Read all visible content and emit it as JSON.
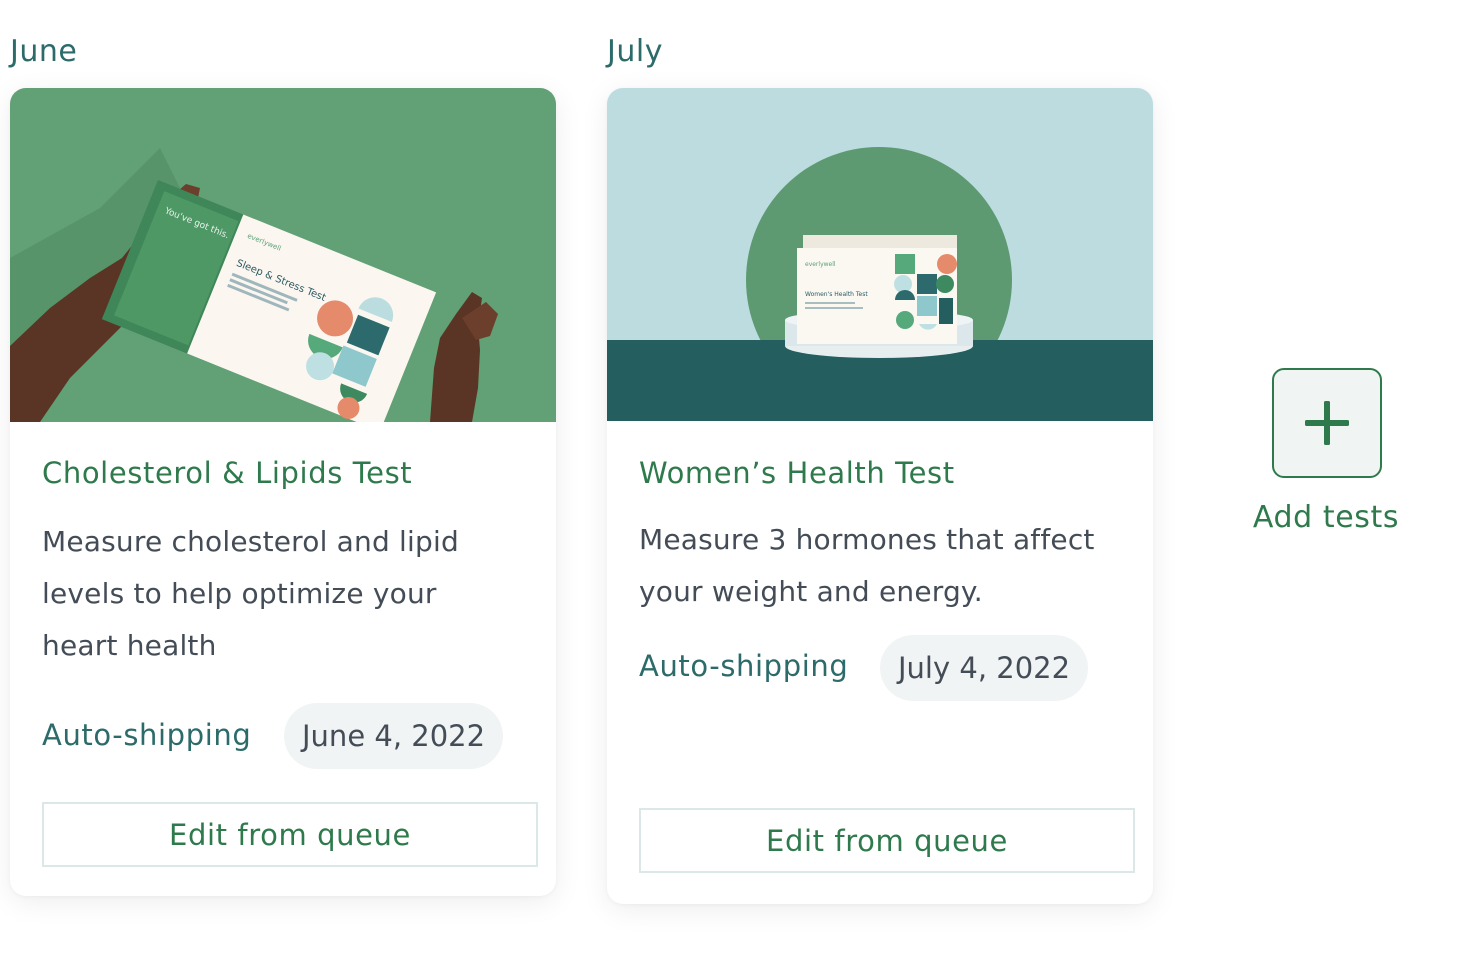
{
  "columns": [
    {
      "month": "June",
      "test": {
        "title": "Cholesterol & Lipids Test",
        "description": "Measure cholesterol and lipid levels to help optimize your heart health",
        "shipping_label": "Auto-shipping",
        "ship_date": "June 4, 2022",
        "edit_label": "Edit from queue",
        "product_image": {
          "tagline": "You've got this.",
          "brand": "everlywell",
          "box_title": "Sleep & Stress Test"
        }
      }
    },
    {
      "month": "July",
      "test": {
        "title": "Women’s Health Test",
        "description": "Measure 3 hormones that affect your weight and energy.",
        "shipping_label": "Auto-shipping",
        "ship_date": "July 4, 2022",
        "edit_label": "Edit from queue",
        "product_image": {
          "brand": "everlywell",
          "box_title": "Women's Health Test"
        }
      }
    }
  ],
  "add_tests": {
    "label": "Add tests",
    "icon": "plus-icon"
  },
  "colors": {
    "brand_green": "#2f7a4c",
    "teal_text": "#2c6b6a",
    "body_text": "#444d57",
    "chip_bg": "#f1f4f5",
    "june_image_bg": "#62a075",
    "july_sky": "#bddcdf",
    "july_floor": "#245e5f"
  }
}
